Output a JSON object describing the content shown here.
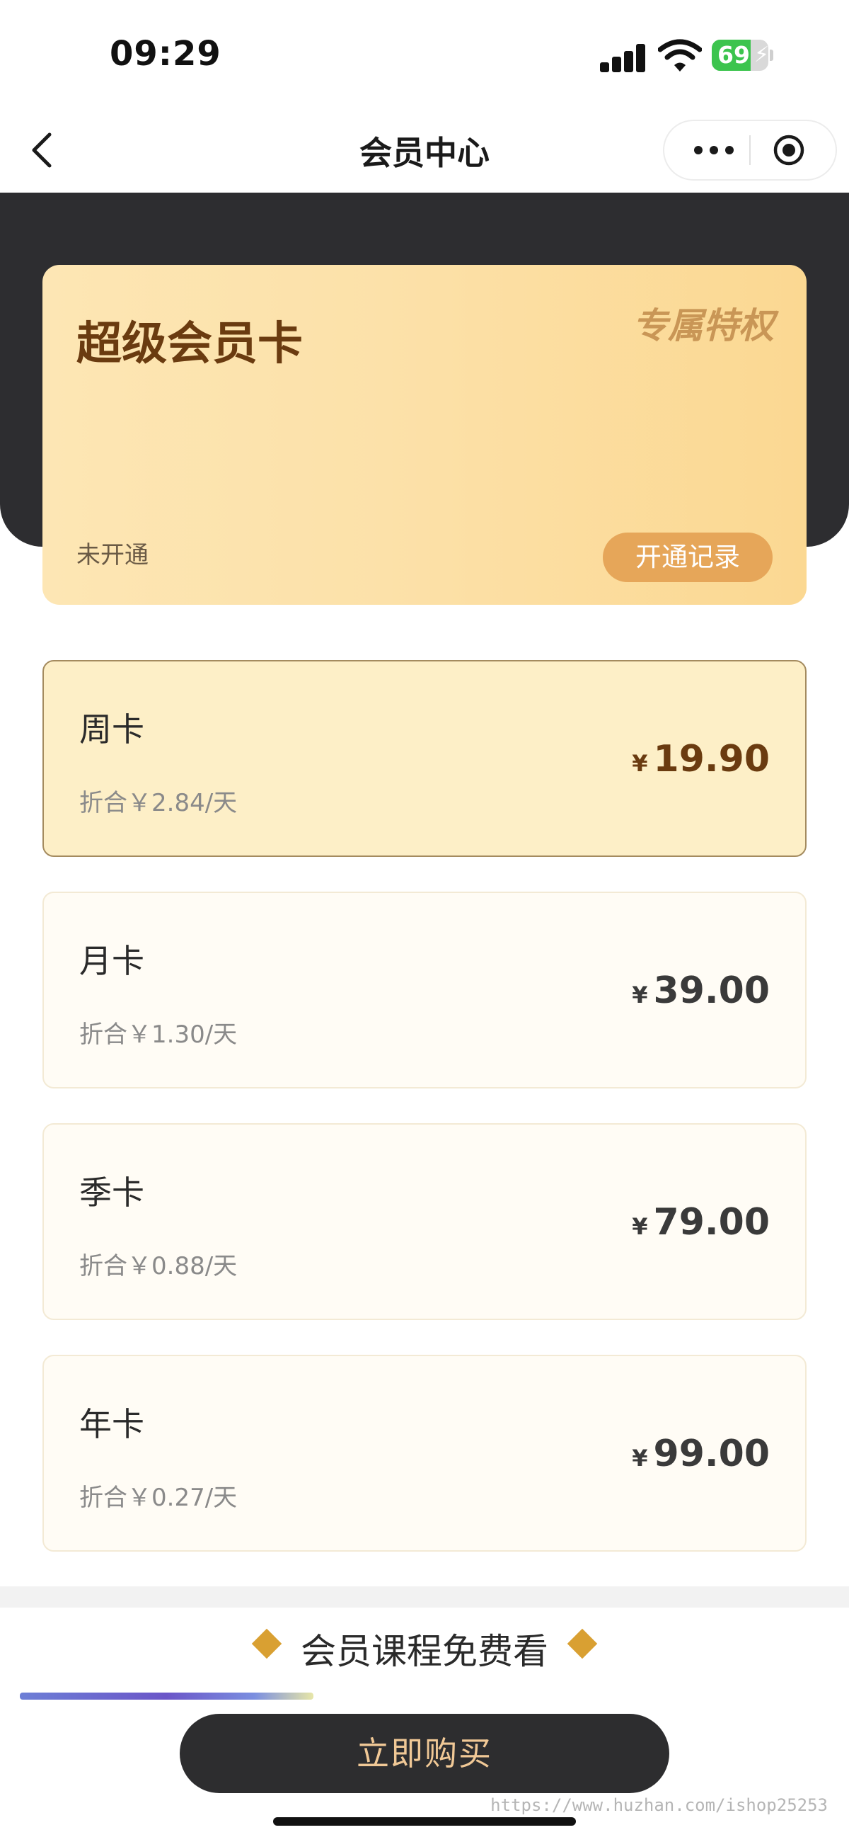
{
  "status_bar": {
    "time": "09:29",
    "battery": "69",
    "battery_level": 0.69
  },
  "nav": {
    "title": "会员中心"
  },
  "member_card": {
    "title": "超级会员卡",
    "privilege": "专属特权",
    "status": "未开通",
    "record_button": "开通记录"
  },
  "plans": [
    {
      "name": "周卡",
      "per_day": "折合￥2.84/天",
      "currency": "¥",
      "price": "19.90",
      "selected": true
    },
    {
      "name": "月卡",
      "per_day": "折合￥1.30/天",
      "currency": "¥",
      "price": "39.00",
      "selected": false
    },
    {
      "name": "季卡",
      "per_day": "折合￥0.88/天",
      "currency": "¥",
      "price": "79.00",
      "selected": false
    },
    {
      "name": "年卡",
      "per_day": "折合￥0.27/天",
      "currency": "¥",
      "price": "99.00",
      "selected": false
    }
  ],
  "section": {
    "heading": "会员课程免费看"
  },
  "buy_button": "立即购买",
  "watermark": "https://www.huzhan.com/ishop25253",
  "colors": {
    "dark": "#2d2d30",
    "gold_accent": "#d9a032",
    "card_gold": "#fce1a9",
    "buy_text": "#f0c896",
    "battery_green": "#3cc44e"
  }
}
